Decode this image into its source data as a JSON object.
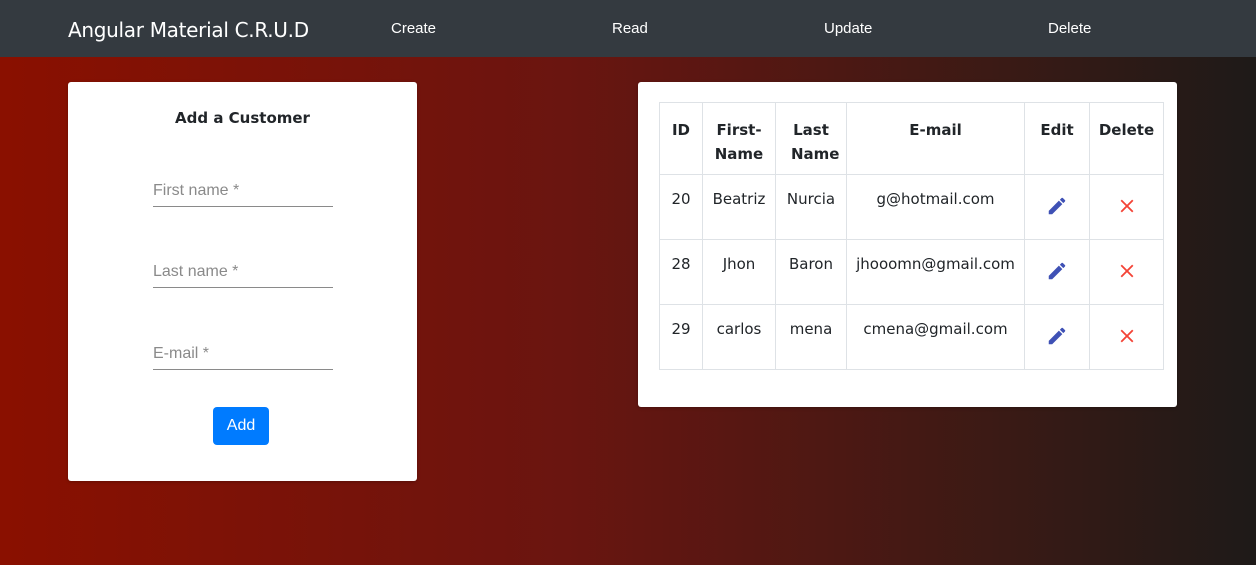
{
  "navbar": {
    "brand": "Angular Material C.R.U.D",
    "links": [
      "Create",
      "Read",
      "Update",
      "Delete"
    ]
  },
  "form": {
    "title": "Add a Customer",
    "first_name_placeholder": "First name *",
    "last_name_placeholder": "Last name *",
    "email_placeholder": "E-mail *",
    "add_label": "Add"
  },
  "table": {
    "headers": [
      "ID",
      "First-Name",
      "Last Name",
      "E-mail",
      "Edit",
      "Delete"
    ],
    "rows": [
      {
        "id": "20",
        "first": "Beatriz",
        "last": "Nurcia",
        "email": "g@hotmail.com"
      },
      {
        "id": "28",
        "first": "Jhon",
        "last": "Baron",
        "email": "jhooomn@gmail.com"
      },
      {
        "id": "29",
        "first": "carlos",
        "last": "mena",
        "email": "cmena@gmail.com"
      }
    ],
    "edit_icon": "pencil-icon",
    "delete_icon": "close-icon"
  },
  "colors": {
    "navbar": "#343a40",
    "primary_button": "#007bff",
    "edit_icon": "#3f51b5",
    "delete_icon": "#f44336"
  }
}
